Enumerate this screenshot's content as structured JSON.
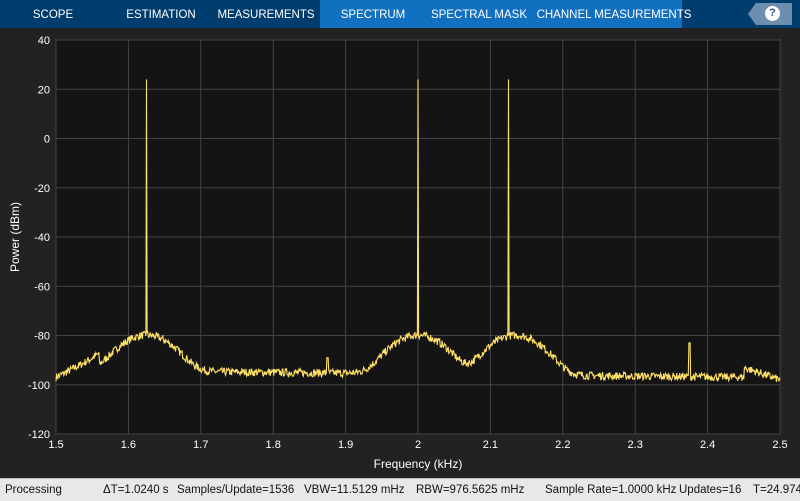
{
  "toolbar": {
    "tabs": [
      "SCOPE",
      "ESTIMATION",
      "MEASUREMENTS",
      "SPECTRUM",
      "SPECTRAL MASK",
      "CHANNEL MEASUREMENTS"
    ],
    "help": "?"
  },
  "colors": {
    "toolbar": "#003d6f",
    "active_group": "#1270c1",
    "trace": "#ffe066",
    "plot_bg": "#141414"
  },
  "chart_data": {
    "type": "line",
    "xlabel": "Frequency (kHz)",
    "ylabel": "Power (dBm)",
    "xlim": [
      1.5,
      2.5
    ],
    "ylim": [
      -120,
      40
    ],
    "grid": true,
    "xticks": [
      "1.5",
      "1.6",
      "1.7",
      "1.8",
      "1.9",
      "2",
      "2.1",
      "2.2",
      "2.3",
      "2.4",
      "2.5"
    ],
    "yticks": [
      "40",
      "20",
      "0",
      "-20",
      "-40",
      "-60",
      "-80",
      "-100",
      "-120"
    ],
    "noise_floor_dbm": -95,
    "tones": [
      {
        "freq": 1.625,
        "power": 24
      },
      {
        "freq": 2.0,
        "power": 24
      },
      {
        "freq": 2.125,
        "power": 24
      }
    ],
    "humps": [
      {
        "freq": 1.625,
        "power": -80
      },
      {
        "freq": 2.0,
        "power": -80
      },
      {
        "freq": 2.135,
        "power": -80
      }
    ],
    "spurs": [
      {
        "freq": 1.875,
        "power": -89
      },
      {
        "freq": 2.375,
        "power": -83
      }
    ],
    "edge_levels": {
      "start": -97,
      "end": -98
    }
  },
  "status": {
    "state": "Processing",
    "dt": "ΔT=1.0240 s",
    "samples": "Samples/Update=1536",
    "vbw": "VBW=11.5129 mHz",
    "rbw": "RBW=976.5625 mHz",
    "rate": "Sample Rate=1.0000 kHz",
    "updates": "Updates=16",
    "t": "T=24.974"
  }
}
